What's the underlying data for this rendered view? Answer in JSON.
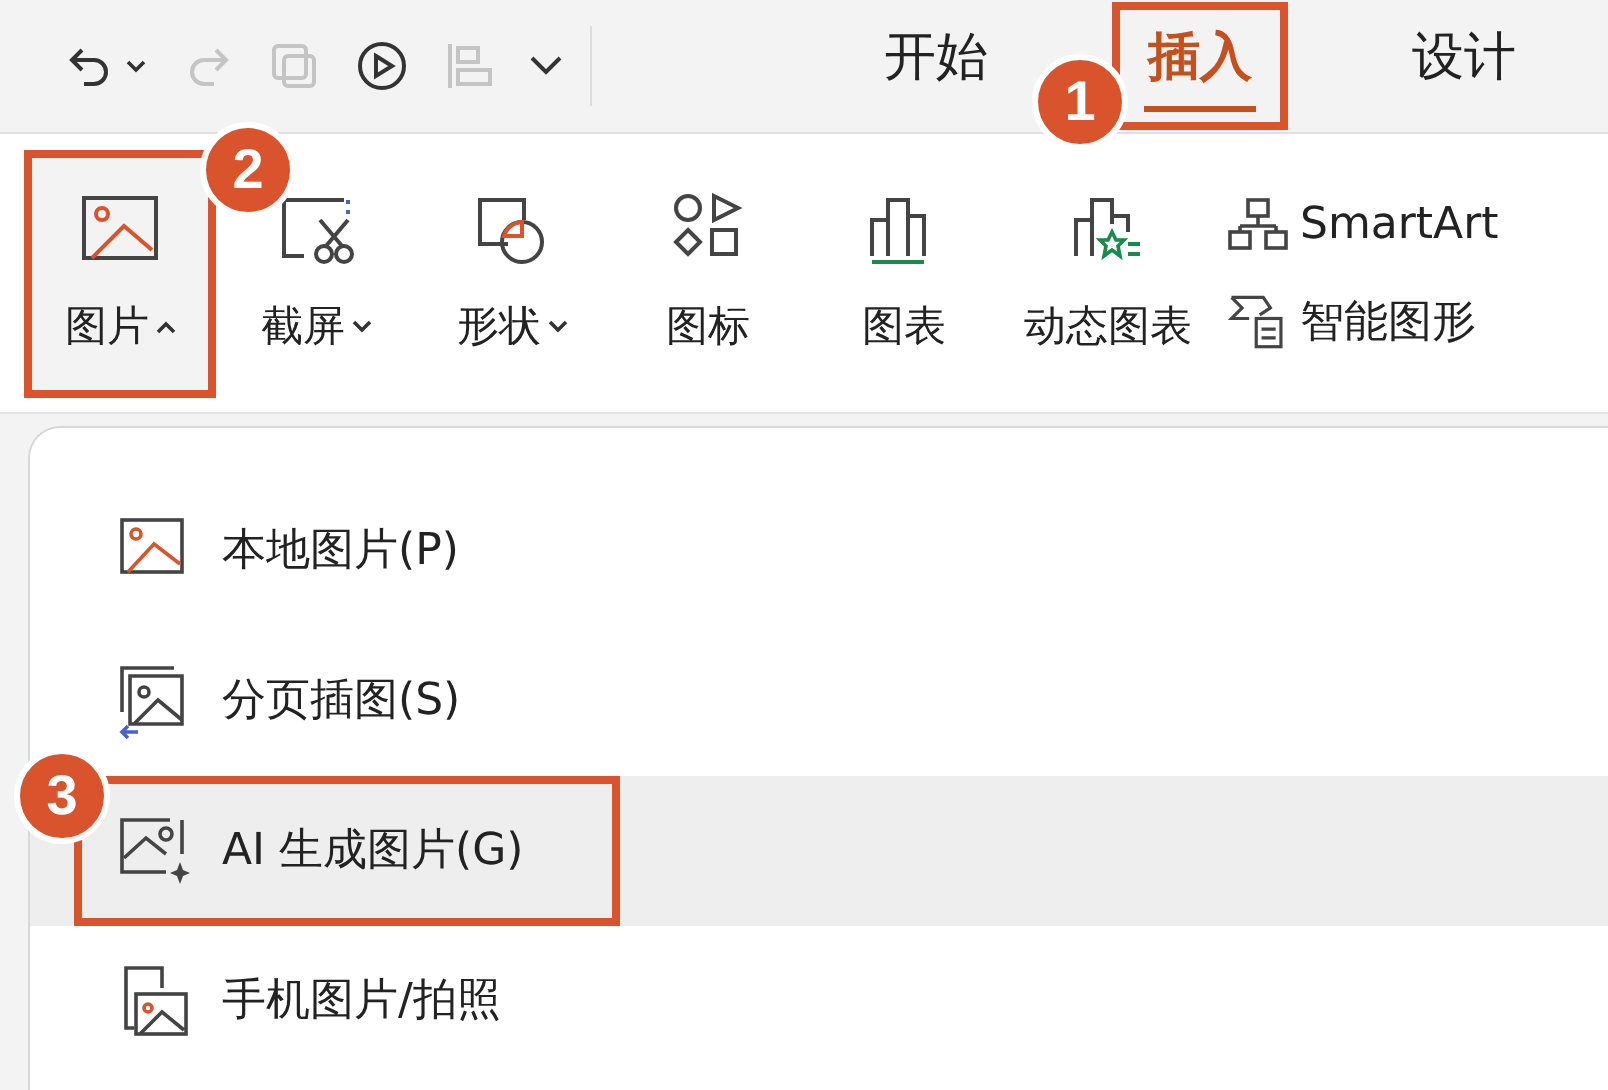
{
  "quick_access": [
    {
      "kind": "undo",
      "disabled": false,
      "dropdown": true
    },
    {
      "kind": "redo",
      "disabled": true,
      "dropdown": false
    },
    {
      "kind": "copy",
      "disabled": true,
      "dropdown": false
    },
    {
      "kind": "play",
      "disabled": false,
      "dropdown": false
    },
    {
      "kind": "align",
      "disabled": true,
      "dropdown": false
    },
    {
      "kind": "more",
      "disabled": false,
      "dropdown": false
    }
  ],
  "tabs": [
    {
      "label": "开始",
      "selected": false,
      "highlighted": false
    },
    {
      "label": "插入",
      "selected": true,
      "highlighted": true,
      "callout": "1"
    },
    {
      "label": "设计",
      "selected": false,
      "highlighted": false
    }
  ],
  "ribbon": {
    "large": [
      {
        "kind": "picture",
        "label": "图片",
        "dropdown": true,
        "expanded": true,
        "highlighted": true,
        "callout": "2"
      },
      {
        "kind": "screenshot",
        "label": "截屏",
        "dropdown": true,
        "expanded": false,
        "highlighted": false
      },
      {
        "kind": "shapes",
        "label": "形状",
        "dropdown": true,
        "expanded": false,
        "highlighted": false
      },
      {
        "kind": "icons",
        "label": "图标",
        "dropdown": false,
        "highlighted": false
      },
      {
        "kind": "chart",
        "label": "图表",
        "dropdown": false,
        "highlighted": false
      },
      {
        "kind": "dynamic-chart",
        "label": "动态图表",
        "dropdown": false,
        "highlighted": false
      }
    ],
    "small": [
      {
        "kind": "smartart",
        "label": "SmartArt"
      },
      {
        "kind": "smart-graphic",
        "label": "智能图形"
      }
    ]
  },
  "menu": [
    {
      "kind": "local",
      "label": "本地图片(P)",
      "selected": false,
      "highlighted": false
    },
    {
      "kind": "page",
      "label": "分页插图(S)",
      "selected": false,
      "highlighted": false
    },
    {
      "kind": "ai",
      "label": "AI 生成图片(G)",
      "selected": true,
      "highlighted": true,
      "callout": "3"
    },
    {
      "kind": "phone",
      "label": "手机图片/拍照",
      "selected": false,
      "highlighted": false
    }
  ]
}
